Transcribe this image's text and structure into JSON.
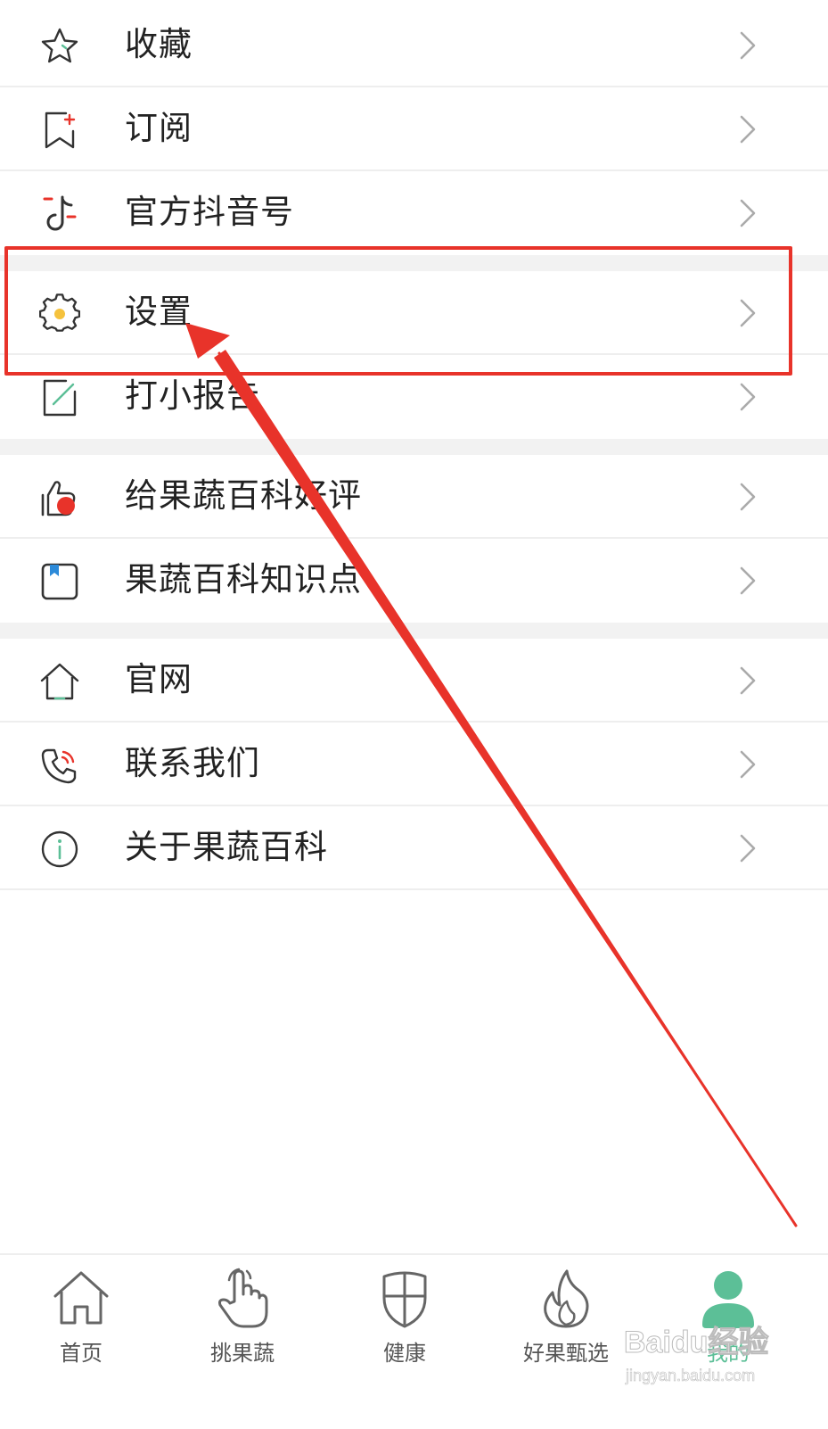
{
  "menu": {
    "items": [
      {
        "label": "收藏",
        "icon": "star-icon"
      },
      {
        "label": "订阅",
        "icon": "subscribe-bookmark-icon"
      },
      {
        "label": "官方抖音号",
        "icon": "douyin-icon"
      },
      {
        "label": "设置",
        "icon": "gear-icon"
      },
      {
        "label": "打小报告",
        "icon": "report-edit-icon"
      },
      {
        "label": "给果蔬百科好评",
        "icon": "thumbs-up-icon"
      },
      {
        "label": "果蔬百科知识点",
        "icon": "knowledge-book-icon"
      },
      {
        "label": "官网",
        "icon": "home-outline-icon"
      },
      {
        "label": "联系我们",
        "icon": "phone-icon"
      },
      {
        "label": "关于果蔬百科",
        "icon": "info-icon"
      }
    ]
  },
  "tabbar": {
    "tabs": [
      {
        "label": "首页",
        "icon": "home-icon",
        "active": false
      },
      {
        "label": "挑果蔬",
        "icon": "hand-pointer-icon",
        "active": false
      },
      {
        "label": "健康",
        "icon": "shield-icon",
        "active": false
      },
      {
        "label": "好果甄选",
        "icon": "flame-icon",
        "active": false
      },
      {
        "label": "我的",
        "icon": "user-icon",
        "active": true
      }
    ]
  },
  "annotation": {
    "highlighted_item": "设置",
    "color": "#e8332a"
  },
  "watermark": {
    "brand": "Baidu经验",
    "url": "jingyan.baidu.com"
  },
  "colors": {
    "accent": "#5cbf97",
    "annotation_red": "#e8332a",
    "divider": "#eeeeee",
    "section_gap": "#f2f2f2"
  }
}
